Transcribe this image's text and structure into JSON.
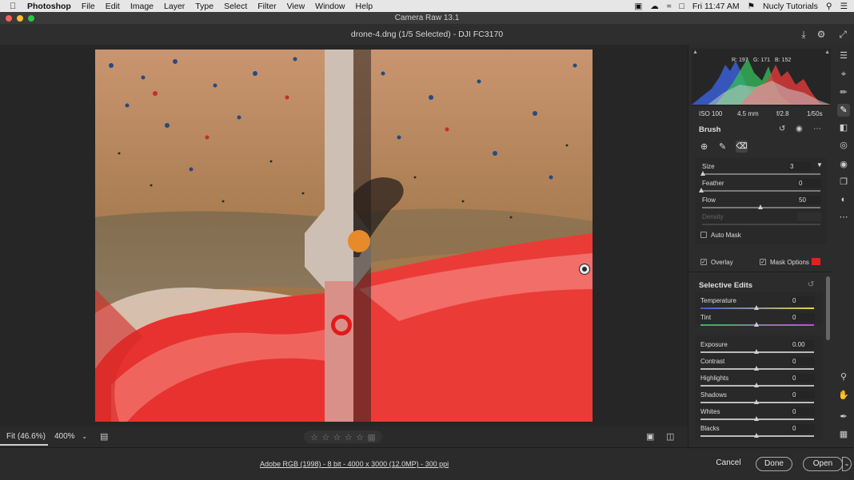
{
  "menubar": {
    "items": [
      "Photoshop",
      "File",
      "Edit",
      "Image",
      "Layer",
      "Type",
      "Select",
      "Filter",
      "View",
      "Window",
      "Help"
    ],
    "clock": "Fri 11:47 AM",
    "user": "Nucly Tutorials"
  },
  "window": {
    "title": "Camera Raw 13.1"
  },
  "header": {
    "file": "drone-4.dng (1/5 Selected)  -  DJI FC3170"
  },
  "histogram": {
    "r": "R: 197",
    "g": "G: 171",
    "b": "B: 152"
  },
  "exif": {
    "iso": "ISO 100",
    "focal": "4.5 mm",
    "aperture": "f/2.8",
    "shutter": "1/50s"
  },
  "brush": {
    "title": "Brush",
    "size_label": "Size",
    "size_value": "3",
    "feather_label": "Feather",
    "feather_value": "0",
    "flow_label": "Flow",
    "flow_value": "50",
    "density_label": "Density",
    "auto_mask_label": "Auto Mask",
    "overlay_label": "Overlay",
    "mask_options_label": "Mask Options",
    "mask_color": "#e81e1e"
  },
  "selective_edits": {
    "title": "Selective Edits",
    "sliders": [
      {
        "label": "Temperature",
        "value": "0"
      },
      {
        "label": "Tint",
        "value": "0"
      },
      {
        "label": "Exposure",
        "value": "0.00"
      },
      {
        "label": "Contrast",
        "value": "0"
      },
      {
        "label": "Highlights",
        "value": "0"
      },
      {
        "label": "Shadows",
        "value": "0"
      },
      {
        "label": "Whites",
        "value": "0"
      },
      {
        "label": "Blacks",
        "value": "0"
      }
    ]
  },
  "canvas_bar": {
    "fit": "Fit (46.6%)",
    "zoom": "400%"
  },
  "status": {
    "file_info": "Adobe RGB (1998) - 8 bit - 4000 x 3000 (12.0MP) - 300 ppi",
    "cancel": "Cancel",
    "done": "Done",
    "open": "Open"
  },
  "colors": {
    "accent_red": "#e81e1e",
    "panel_bg": "#2c2c2c"
  }
}
